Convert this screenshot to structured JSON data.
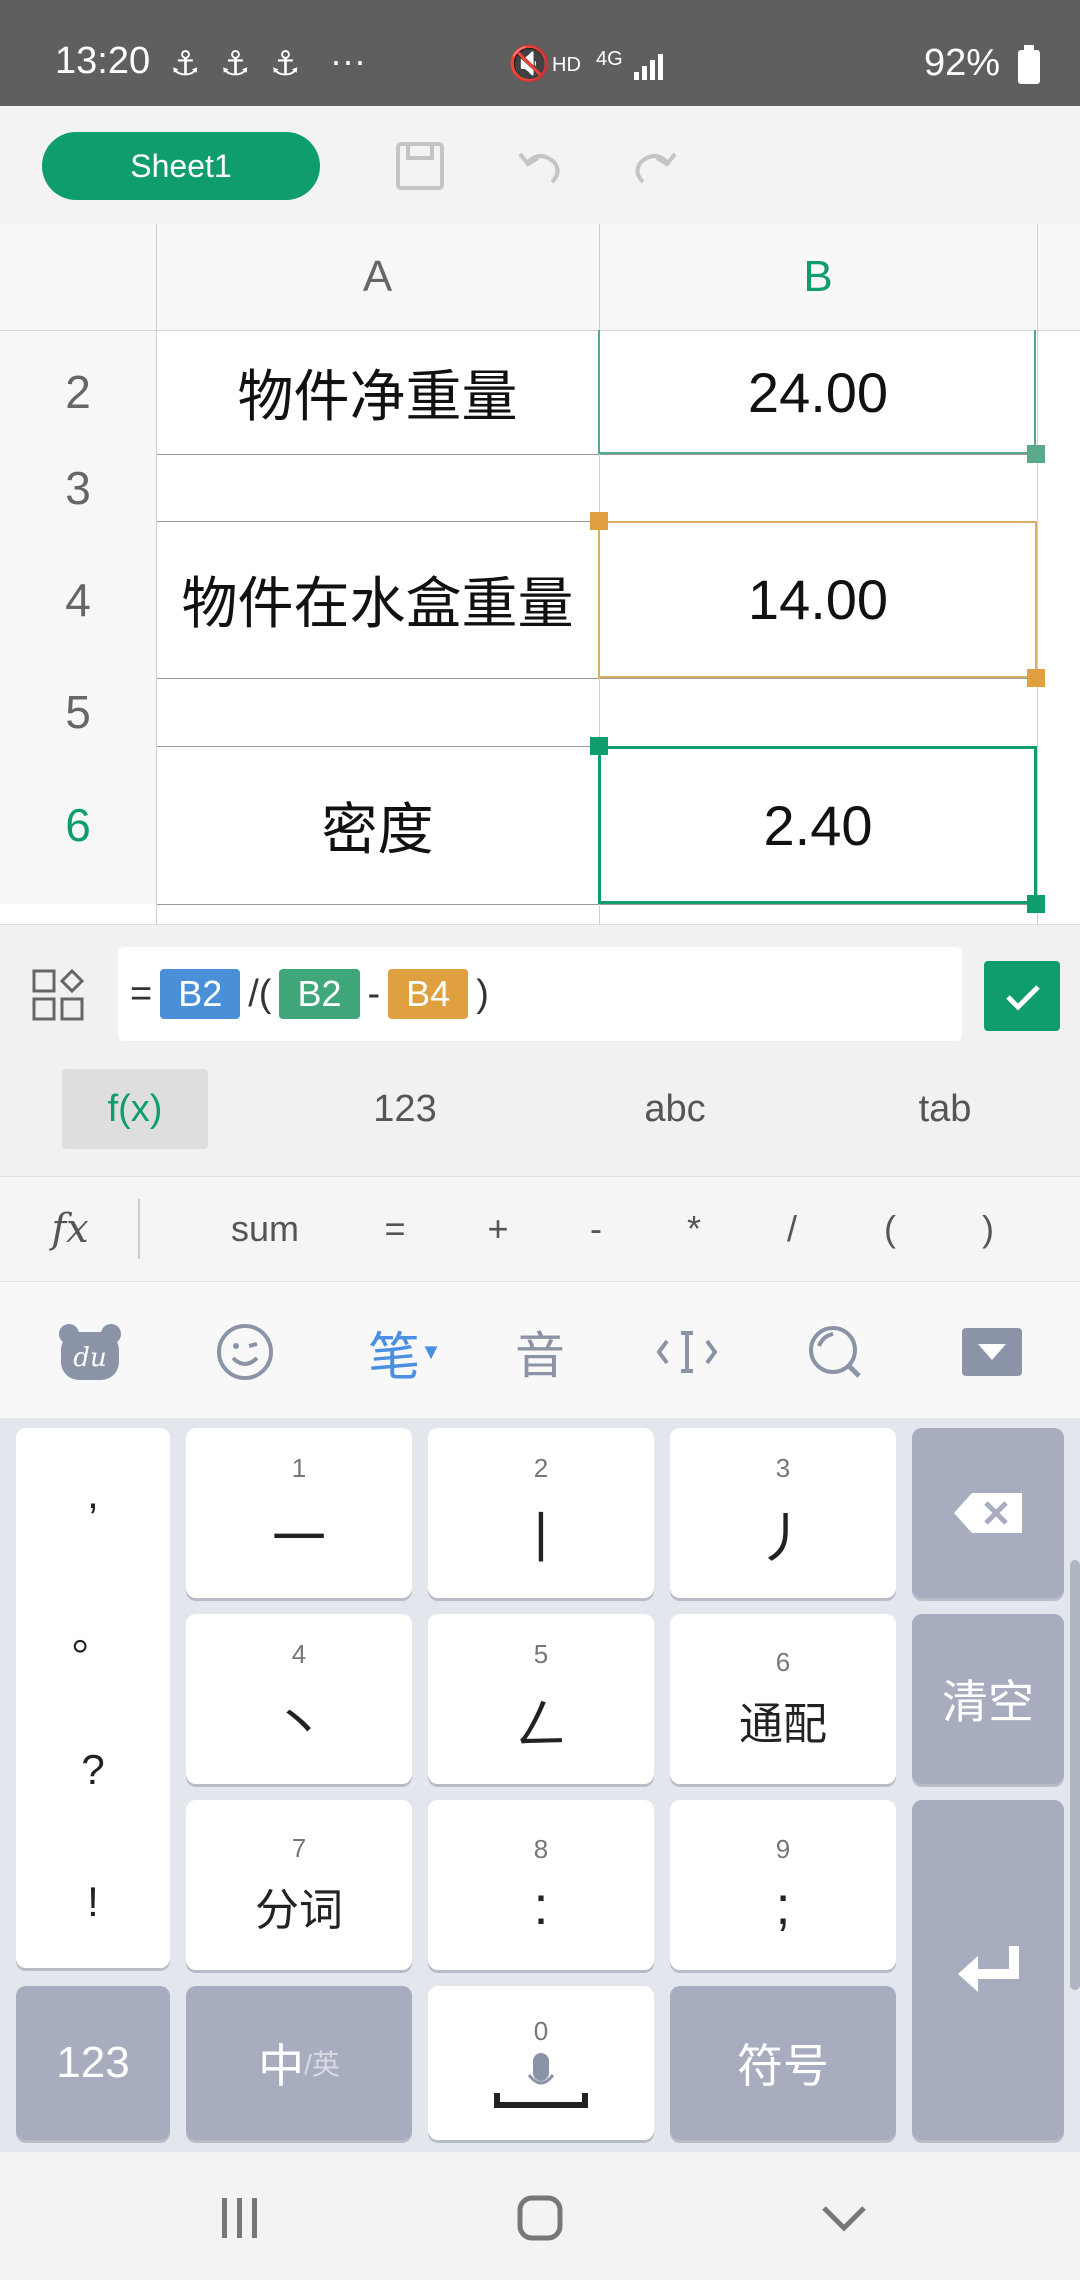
{
  "status_bar": {
    "time": "13:20",
    "dots": "···",
    "network": "4G",
    "hd": "HD",
    "battery": "92%"
  },
  "toolbar": {
    "sheet_tab": "Sheet1",
    "icons": [
      "save-icon",
      "undo-icon",
      "redo-icon"
    ]
  },
  "grid": {
    "columns": [
      "A",
      "B"
    ],
    "rows": [
      {
        "num": "2",
        "a": "物件净重量",
        "b": "24.00"
      },
      {
        "num": "3",
        "a": "",
        "b": ""
      },
      {
        "num": "4",
        "a": "物件在水盒重量",
        "b": "14.00"
      },
      {
        "num": "5",
        "a": "",
        "b": ""
      },
      {
        "num": "6",
        "a": "密度",
        "b": "2.40"
      }
    ],
    "colors": {
      "accent": "#0f9d6c",
      "ref_blue": "#4a90d9",
      "ref_orange": "#e0a040"
    }
  },
  "formula": {
    "eq": "=",
    "ref1": "B2",
    "op1": "/(",
    "ref2": "B2",
    "op2": "-",
    "ref3": "B4",
    "op3": ")"
  },
  "modes": [
    "f(x)",
    "123",
    "abc",
    "tab"
  ],
  "quick_bar": {
    "fx": "fx",
    "items": [
      "sum",
      "=",
      "+",
      "-",
      "*",
      "/",
      "(",
      ")"
    ]
  },
  "keyboard": {
    "punct": [
      ",",
      "。",
      "?",
      "!"
    ],
    "keys": [
      {
        "num": "1",
        "main": "一"
      },
      {
        "num": "2",
        "main": "丨"
      },
      {
        "num": "3",
        "main": "丿"
      },
      {
        "num": "4",
        "main": "丶"
      },
      {
        "num": "5",
        "main": "ㄥ"
      },
      {
        "num": "6",
        "main": "通配"
      },
      {
        "num": "7",
        "main": "分词"
      },
      {
        "num": "8",
        "main": ":"
      },
      {
        "num": "9",
        "main": ";"
      }
    ],
    "clear": "清空",
    "bottom": {
      "k123": "123",
      "zh": "中",
      "en": "/英",
      "zero": "0",
      "symbol": "符号"
    },
    "toolbar": {
      "pen": "笔",
      "sound": "音"
    }
  }
}
